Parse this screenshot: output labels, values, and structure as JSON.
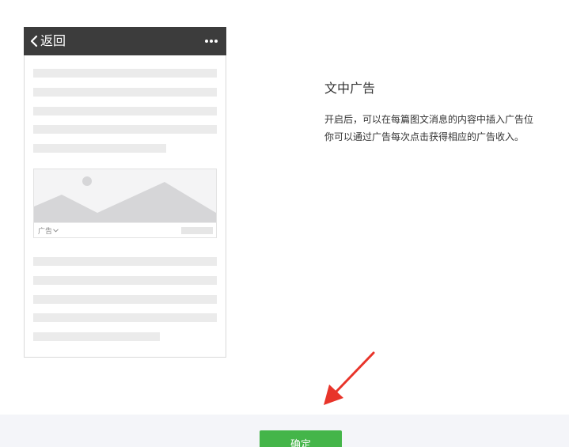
{
  "phone": {
    "back_label": "返回",
    "ad_label": "广告"
  },
  "description": {
    "title": "文中广告",
    "line1": "开启后，可以在每篇图文消息的内容中插入广告位",
    "line2": "你可以通过广告每次点击获得相应的广告收入。"
  },
  "footer": {
    "confirm_label": "确定"
  },
  "colors": {
    "header_bg": "#3c3c3c",
    "confirm_green": "#44b549",
    "arrow_red": "#e8342a",
    "placeholder_gray": "#ebebeb"
  },
  "icons": {
    "back": "chevron-left-icon",
    "more": "more-dots-icon",
    "ad_dropdown": "chevron-down-icon",
    "image_placeholder": "landscape-placeholder-icon",
    "annotation": "red-arrow-icon"
  }
}
